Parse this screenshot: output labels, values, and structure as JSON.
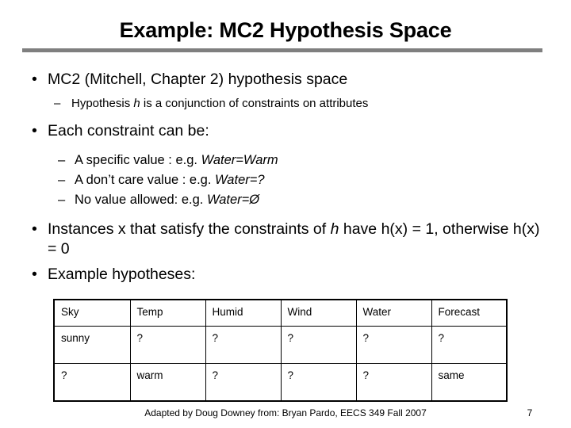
{
  "slide": {
    "title": "Example: MC2 Hypothesis Space",
    "rule_color": "#7f7f7f",
    "background_color": "#ffffff",
    "text_color": "#000000"
  },
  "bullets": {
    "b1": "MC2 (Mitchell, Chapter 2) hypothesis space",
    "b1_sub1_pre": "Hypothesis ",
    "b1_sub1_italic": "h",
    "b1_sub1_post": " is a conjunction of constraints on attributes",
    "b2": "Each constraint can be:",
    "b2_sub1_pre": "A specific value : e.g. ",
    "b2_sub1_italic": "Water=Warm",
    "b2_sub2_pre": "A don’t care value : e.g. ",
    "b2_sub2_italic": "Water=?",
    "b2_sub3_pre": "No value allowed: e.g. ",
    "b2_sub3_italic": "Water=Ø",
    "b3_pre": "Instances x that satisfy the constraints of ",
    "b3_italic": "h",
    "b3_post": " have h(x) = 1, otherwise h(x) = 0",
    "b4": "Example hypotheses:",
    "bullet_glyph": "•",
    "dash_glyph": "–"
  },
  "table": {
    "headers": [
      "Sky",
      "Temp",
      "Humid",
      "Wind",
      "Water",
      "Forecast"
    ],
    "rows": [
      [
        "sunny",
        "?",
        "?",
        "?",
        "?",
        "?"
      ],
      [
        "?",
        "warm",
        "?",
        "?",
        "?",
        "same"
      ]
    ]
  },
  "footer": {
    "credit": "Adapted by Doug Downey from: Bryan Pardo, EECS 349 Fall 2007",
    "page_number": "7"
  }
}
